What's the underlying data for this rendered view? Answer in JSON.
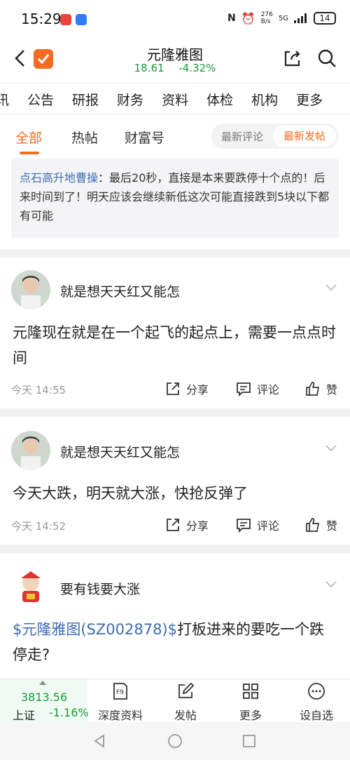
{
  "status_bar": {
    "time": "15:29",
    "speed_top": "276",
    "speed_bottom": "B/s",
    "network": "5G",
    "battery": "14"
  },
  "header": {
    "title": "元隆雅图",
    "price": "18.61",
    "change": "-4.32%",
    "colors": {
      "brand": "#f36c21",
      "down": "#1a9a3c",
      "link": "#3d6bb3"
    }
  },
  "tabs_main": [
    "讯",
    "公告",
    "研报",
    "财务",
    "资料",
    "体检",
    "机构",
    "更多"
  ],
  "tabs_sub": {
    "items": [
      "全部",
      "热帖",
      "财富号"
    ],
    "active": "全部",
    "sort_options": [
      "最新评论",
      "最新发帖"
    ],
    "sort_active": "最新发帖"
  },
  "quoted": {
    "author": "点石高升地曹操",
    "text": "：最后20秒，直接是本来要跌停十个点的！后来时间到了！明天应该会继续新低这次可能直接跌到5块以下都有可能"
  },
  "posts": [
    {
      "username": "就是想天天红又能怎",
      "content": "元隆现在就是在一个起飞的起点上，需要一点点时间",
      "time": "今天 14:55",
      "actions": {
        "share": "分享",
        "comment": "评论",
        "like": "赞"
      }
    },
    {
      "username": "就是想天天红又能怎",
      "content": "今天大跌，明天就大涨，快抢反弹了",
      "time": "今天 14:52",
      "actions": {
        "share": "分享",
        "comment": "评论",
        "like": "赞"
      }
    },
    {
      "username": "要有钱要大涨",
      "content_link": "$元隆雅图(SZ002878)$",
      "content": "打板进来的要吃一个跌停走?"
    }
  ],
  "bottom_nav": {
    "index_value": "3813.56",
    "index_name": "上证",
    "index_change": "-1.16%",
    "items": [
      "深度资料",
      "发帖",
      "更多",
      "设自选"
    ],
    "f9_badge": "F9"
  }
}
